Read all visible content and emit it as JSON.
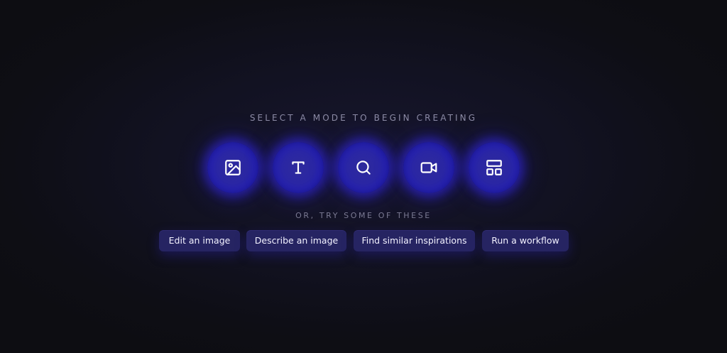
{
  "heading": "SELECT A MODE TO BEGIN CREATING",
  "subheading": "OR, TRY SOME OF THESE",
  "modes": [
    {
      "icon": "image-icon"
    },
    {
      "icon": "text-icon"
    },
    {
      "icon": "search-icon"
    },
    {
      "icon": "video-icon"
    },
    {
      "icon": "layout-icon"
    }
  ],
  "suggestions": [
    {
      "label": "Edit an image"
    },
    {
      "label": "Describe an image"
    },
    {
      "label": "Find similar inspirations"
    },
    {
      "label": "Run a workflow"
    }
  ],
  "colors": {
    "background": "#121222",
    "accent": "#2a26a4",
    "chip": "#262462",
    "muted_text": "#8d8ca6"
  }
}
